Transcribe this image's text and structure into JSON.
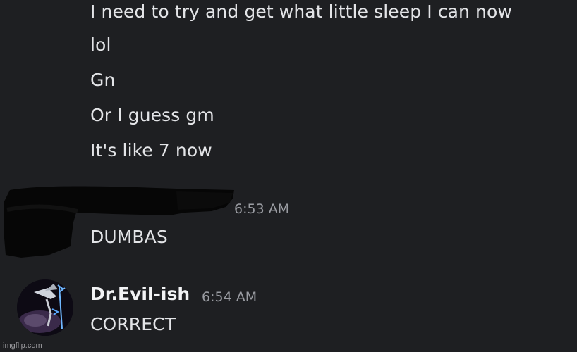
{
  "previous_messages": [
    "I need to try and get what little sleep I can now",
    "lol",
    "Gn",
    "Or I guess gm",
    "It's like 7 now"
  ],
  "redacted_message": {
    "timestamp": "6:53 AM",
    "text": "DUMBAS"
  },
  "reply_message": {
    "username": "Dr.Evil-ish",
    "timestamp": "6:54 AM",
    "text": "CORRECT",
    "avatar_icon": "winged-figure-avatar"
  },
  "watermark": "imgflip.com",
  "colors": {
    "background": "#1e1f22",
    "message_text": "#e3e4e7",
    "timestamp": "#9a9ca2",
    "username": "#f2f3f5",
    "redaction": "#060606"
  }
}
